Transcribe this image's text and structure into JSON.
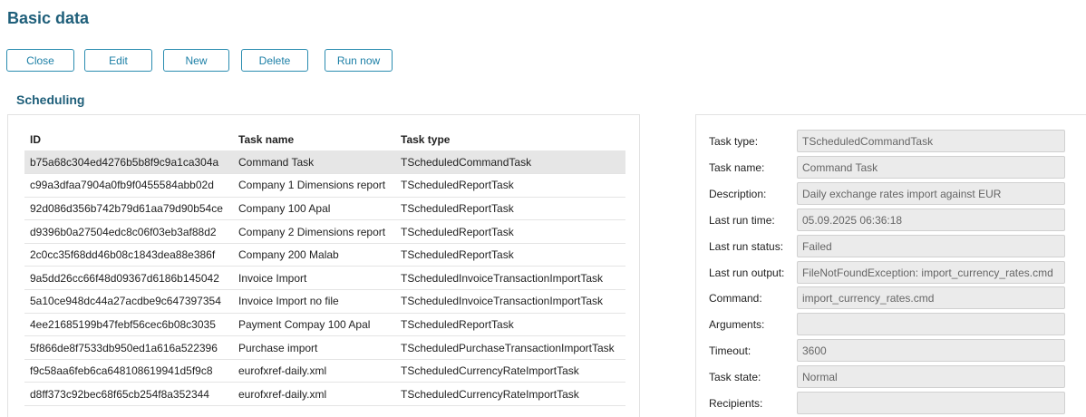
{
  "page_title": "Basic data",
  "toolbar": {
    "close_label": "Close",
    "edit_label": "Edit",
    "new_label": "New",
    "delete_label": "Delete",
    "run_now_label": "Run now"
  },
  "section_title": "Scheduling",
  "grid": {
    "columns": [
      "ID",
      "Task name",
      "Task type"
    ],
    "rows": [
      {
        "id": "b75a68c304ed4276b5b8f9c9a1ca304a",
        "name": "Command Task",
        "type": "TScheduledCommandTask"
      },
      {
        "id": "c99a3dfaa7904a0fb9f0455584abb02d",
        "name": "Company 1 Dimensions report",
        "type": "TScheduledReportTask"
      },
      {
        "id": "92d086d356b742b79d61aa79d90b54ce",
        "name": "Company 100 Apal",
        "type": "TScheduledReportTask"
      },
      {
        "id": "d9396b0a27504edc8c06f03eb3af88d2",
        "name": "Company 2 Dimensions report",
        "type": "TScheduledReportTask"
      },
      {
        "id": "2c0cc35f68dd46b08c1843dea88e386f",
        "name": "Company 200 Malab",
        "type": "TScheduledReportTask"
      },
      {
        "id": "9a5dd26cc66f48d09367d6186b145042",
        "name": "Invoice Import",
        "type": "TScheduledInvoiceTransactionImportTask"
      },
      {
        "id": "5a10ce948dc44a27acdbe9c647397354",
        "name": "Invoice Import no file",
        "type": "TScheduledInvoiceTransactionImportTask"
      },
      {
        "id": "4ee21685199b47febf56cec6b08c3035",
        "name": "Payment Compay 100 Apal",
        "type": "TScheduledReportTask"
      },
      {
        "id": "5f866de8f7533db950ed1a616a522396",
        "name": "Purchase import",
        "type": "TScheduledPurchaseTransactionImportTask"
      },
      {
        "id": "f9c58aa6feb6ca648108619941d5f9c8",
        "name": "eurofxref-daily.xml",
        "type": "TScheduledCurrencyRateImportTask"
      },
      {
        "id": "d8ff373c92bec68f65cb254f8a352344",
        "name": "eurofxref-daily.xml",
        "type": "TScheduledCurrencyRateImportTask"
      }
    ],
    "selected_index": 0
  },
  "details": [
    {
      "key": "task-type",
      "label": "Task type:",
      "value": "TScheduledCommandTask"
    },
    {
      "key": "task-name",
      "label": "Task name:",
      "value": "Command Task"
    },
    {
      "key": "description",
      "label": "Description:",
      "value": "Daily exchange rates import against EUR"
    },
    {
      "key": "last-run-time",
      "label": "Last run time:",
      "value": "05.09.2025 06:36:18"
    },
    {
      "key": "last-run-status",
      "label": "Last run status:",
      "value": "Failed"
    },
    {
      "key": "last-run-output",
      "label": "Last run output:",
      "value": "FileNotFoundException: import_currency_rates.cmd"
    },
    {
      "key": "command",
      "label": "Command:",
      "value": "import_currency_rates.cmd"
    },
    {
      "key": "arguments",
      "label": "Arguments:",
      "value": ""
    },
    {
      "key": "timeout",
      "label": "Timeout:",
      "value": "3600"
    },
    {
      "key": "task-state",
      "label": "Task state:",
      "value": "Normal"
    },
    {
      "key": "recipients",
      "label": "Recipients:",
      "value": ""
    }
  ],
  "colors": {
    "title": "#1f5f7a",
    "button_border": "#2a8cb0",
    "button_text": "#1c7fa6",
    "selected_row": "#e6e6e6",
    "field_bg": "#ebebeb"
  }
}
